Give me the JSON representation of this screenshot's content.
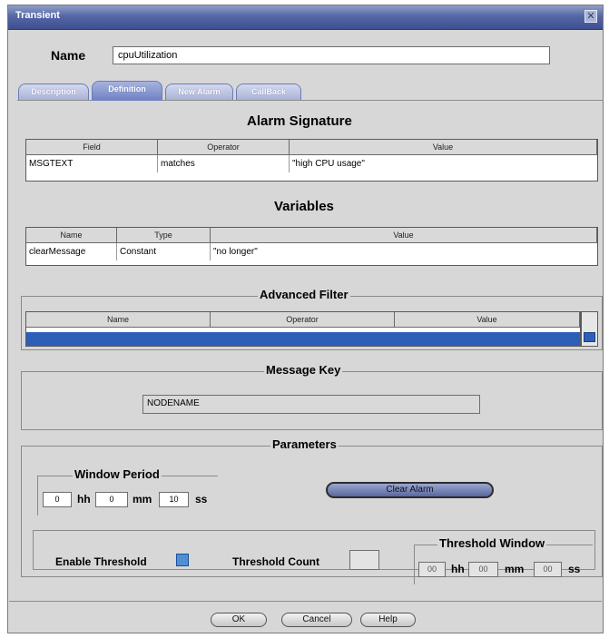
{
  "window": {
    "title": "Transient",
    "close_glyph": "✕"
  },
  "name_field": {
    "label": "Name",
    "value": "cpuUtilization"
  },
  "tabs": [
    {
      "label": "Description",
      "active": false
    },
    {
      "label": "Definition",
      "active": true
    },
    {
      "label": "New Alarm",
      "active": false
    },
    {
      "label": "CallBack",
      "active": false
    }
  ],
  "alarm_signature": {
    "title": "Alarm Signature",
    "columns": [
      "Field",
      "Operator",
      "Value"
    ],
    "rows": [
      [
        "MSGTEXT",
        "matches",
        "\"high CPU usage\""
      ]
    ]
  },
  "variables": {
    "title": "Variables",
    "columns": [
      "Name",
      "Type",
      "Value"
    ],
    "rows": [
      [
        "clearMessage",
        "Constant",
        "\"no longer\""
      ]
    ]
  },
  "advanced_filter": {
    "title": "Advanced Filter",
    "columns": [
      "Name",
      "Operator",
      "Value"
    ],
    "selection_color": "#2e5fb8"
  },
  "message_key": {
    "title": "Message Key",
    "value": "NODENAME"
  },
  "parameters": {
    "title": "Parameters",
    "window_period": {
      "title": "Window Period",
      "hh": "0",
      "mm": "0",
      "ss": "10",
      "hh_label": "hh",
      "mm_label": "mm",
      "ss_label": "ss"
    },
    "clear_alarm_label": "Clear Alarm",
    "enable_threshold_label": "Enable Threshold",
    "threshold_count_label": "Threshold Count",
    "threshold_count_value": "",
    "threshold_window": {
      "title": "Threshold Window",
      "hh": "00",
      "mm": "00",
      "ss": "00",
      "hh_label": "hh",
      "mm_label": "mm",
      "ss_label": "ss"
    }
  },
  "buttons": {
    "ok": "OK",
    "cancel": "Cancel",
    "help": "Help"
  },
  "colors": {
    "titlebar": "#3e4f91",
    "tab_active": "#6f80c2",
    "selection": "#2e5fb8"
  }
}
